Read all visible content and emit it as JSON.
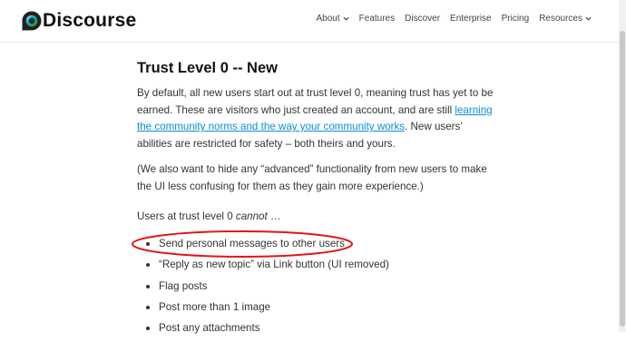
{
  "header": {
    "logo_text": "Discourse",
    "nav": [
      {
        "label": "About",
        "has_dropdown": true
      },
      {
        "label": "Features",
        "has_dropdown": false
      },
      {
        "label": "Discover",
        "has_dropdown": false
      },
      {
        "label": "Enterprise",
        "has_dropdown": false
      },
      {
        "label": "Pricing",
        "has_dropdown": false
      },
      {
        "label": "Resources",
        "has_dropdown": true
      }
    ]
  },
  "article": {
    "title": "Trust Level 0 -- New",
    "p1_before": "By default, all new users start out at trust level 0, meaning trust has yet to be earned. These are visitors who just created an account, and are still ",
    "p1_link": "learning the community norms and the way your community works",
    "p1_after": ". New users’ abilities are restricted for safety – both theirs and yours.",
    "p2": "(We also want to hide any “advanced” functionality from new users to make the UI less confusing for them as they gain more experience.)",
    "p3_before": "Users at trust level 0 ",
    "p3_em": "cannot",
    "p3_after": " …",
    "list": [
      "Send personal messages to other users",
      "“Reply as new topic” via Link button (UI removed)",
      "Flag posts",
      "Post more than 1 image",
      "Post any attachments"
    ]
  },
  "colors": {
    "link": "#0a8ed6",
    "annotation": "#e0161b"
  },
  "icons": [
    "discourse-logo-icon",
    "chevron-down-icon"
  ]
}
